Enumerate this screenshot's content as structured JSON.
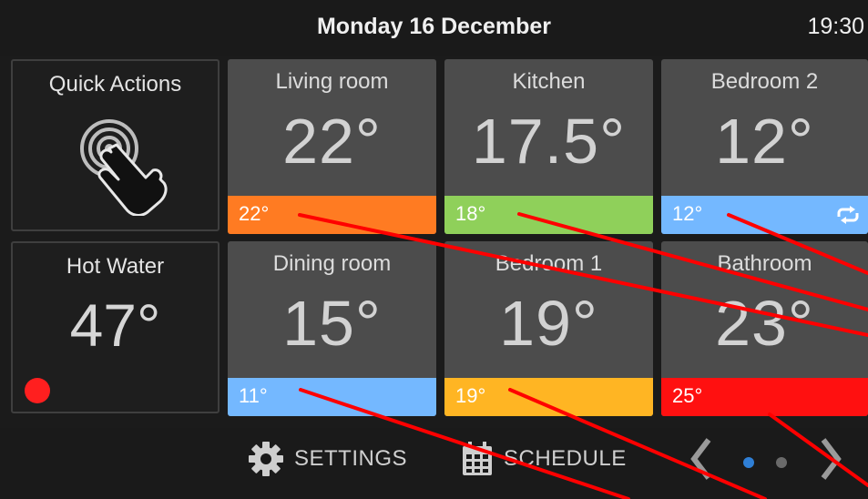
{
  "header": {
    "date": "Monday 16 December",
    "time": "19:30"
  },
  "quick_actions": {
    "title": "Quick Actions",
    "icon": "touch-icon"
  },
  "hot_water": {
    "title": "Hot Water",
    "temperature": "47°",
    "status_color": "#ff1f1f"
  },
  "rooms": [
    {
      "name": "Living room",
      "temperature": "22°",
      "setpoint": "22°",
      "bar_color": "#ff7b22"
    },
    {
      "name": "Kitchen",
      "temperature": "17.5°",
      "setpoint": "18°",
      "bar_color": "#8fd05a"
    },
    {
      "name": "Bedroom 2",
      "temperature": "12°",
      "setpoint": "12°",
      "bar_color": "#74b8ff",
      "icon": "sync-icon"
    },
    {
      "name": "Dining room",
      "temperature": "15°",
      "setpoint": "11°",
      "bar_color": "#74b8ff"
    },
    {
      "name": "Bedroom 1",
      "temperature": "19°",
      "setpoint": "19°",
      "bar_color": "#ffb523"
    },
    {
      "name": "Bathroom",
      "temperature": "23°",
      "setpoint": "25°",
      "bar_color": "#ff1010"
    }
  ],
  "footer": {
    "settings_label": "SETTINGS",
    "schedule_label": "SCHEDULE",
    "icons": [
      "gear-icon",
      "calendar-icon",
      "chevron-left-icon",
      "chevron-right-icon"
    ],
    "page": 1,
    "page_count": 2
  },
  "overlay_line_color": "#ff0000"
}
